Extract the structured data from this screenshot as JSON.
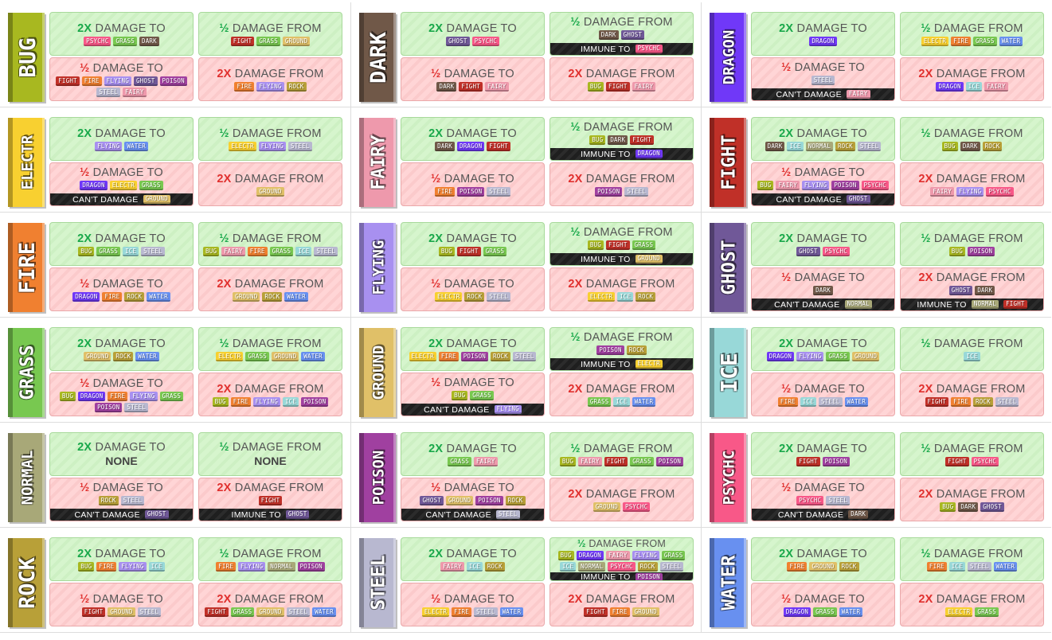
{
  "labels": {
    "damage_to_2x": "DAMAGE TO",
    "damage_to_half": "DAMAGE TO",
    "damage_from_half": "DAMAGE FROM",
    "damage_from_2x": "DAMAGE FROM",
    "mult_2x": "2X",
    "mult_half": "½",
    "cant_damage": "CAN'T DAMAGE",
    "immune_to": "IMMUNE TO",
    "none": "NONE"
  },
  "type_colors": {
    "BUG": "#a8b820",
    "DARK": "#705848",
    "DRAGON": "#7038f8",
    "ELECTR": "#f8d030",
    "FAIRY": "#ee99ac",
    "FIGHT": "#c03028",
    "FIRE": "#f08030",
    "FLYING": "#a890f0",
    "GHOST": "#705898",
    "GRASS": "#78c850",
    "GROUND": "#e0c068",
    "ICE": "#98d8d8",
    "NORMAL": "#a8a878",
    "POISON": "#a040a0",
    "PSYCHC": "#f85888",
    "ROCK": "#b8a038",
    "STEEL": "#b8b8d0",
    "WATER": "#6890f0"
  },
  "types": [
    {
      "name": "BUG",
      "color": "#a8b820",
      "to2x": [
        "PSYCHC",
        "GRASS",
        "DARK"
      ],
      "toHalf": [
        "FIGHT",
        "FIRE",
        "FLYING",
        "GHOST",
        "POISON",
        "STEEL",
        "FAIRY"
      ],
      "fromHalf": [
        "FIGHT",
        "GRASS",
        "GROUND"
      ],
      "from2x": [
        "FIRE",
        "FLYING",
        "ROCK"
      ]
    },
    {
      "name": "DARK",
      "color": "#705848",
      "to2x": [
        "GHOST",
        "PSYCHC"
      ],
      "toHalf": [
        "DARK",
        "FIGHT",
        "FAIRY"
      ],
      "fromHalf": [
        "DARK",
        "GHOST"
      ],
      "immune": [
        "PSYCHC"
      ],
      "from2x": [
        "BUG",
        "FIGHT",
        "FAIRY"
      ]
    },
    {
      "name": "DRAGON",
      "color": "#7038f8",
      "to2x": [
        "DRAGON"
      ],
      "toHalf": [
        "STEEL"
      ],
      "cant": [
        "FAIRY"
      ],
      "fromHalf": [
        "ELECTR",
        "FIRE",
        "GRASS",
        "WATER"
      ],
      "from2x": [
        "DRAGON",
        "ICE",
        "FAIRY"
      ]
    },
    {
      "name": "ELECTR",
      "color": "#f8d030",
      "to2x": [
        "FLYING",
        "WATER"
      ],
      "toHalf": [
        "DRAGON",
        "ELECTR",
        "GRASS"
      ],
      "cant": [
        "GROUND"
      ],
      "fromHalf": [
        "ELECTR",
        "FLYING",
        "STEEL"
      ],
      "from2x": [
        "GROUND"
      ]
    },
    {
      "name": "FAIRY",
      "color": "#ee99ac",
      "to2x": [
        "DARK",
        "DRAGON",
        "FIGHT"
      ],
      "toHalf": [
        "FIRE",
        "POISON",
        "STEEL"
      ],
      "fromHalf": [
        "BUG",
        "DARK",
        "FIGHT"
      ],
      "immune": [
        "DRAGON"
      ],
      "from2x": [
        "POISON",
        "STEEL"
      ]
    },
    {
      "name": "FIGHT",
      "color": "#c03028",
      "to2x": [
        "DARK",
        "ICE",
        "NORMAL",
        "ROCK",
        "STEEL"
      ],
      "toHalf": [
        "BUG",
        "FAIRY",
        "FLYING",
        "POISON",
        "PSYCHC"
      ],
      "cant": [
        "GHOST"
      ],
      "fromHalf": [
        "BUG",
        "DARK",
        "ROCK"
      ],
      "from2x": [
        "FAIRY",
        "FLYING",
        "PSYCHC"
      ]
    },
    {
      "name": "FIRE",
      "color": "#f08030",
      "to2x": [
        "BUG",
        "GRASS",
        "ICE",
        "STEEL"
      ],
      "toHalf": [
        "DRAGON",
        "FIRE",
        "ROCK",
        "WATER"
      ],
      "fromHalf": [
        "BUG",
        "FAIRY",
        "FIRE",
        "GRASS",
        "ICE",
        "STEEL"
      ],
      "from2x": [
        "GROUND",
        "ROCK",
        "WATER"
      ]
    },
    {
      "name": "FLYING",
      "color": "#a890f0",
      "to2x": [
        "BUG",
        "FIGHT",
        "GRASS"
      ],
      "toHalf": [
        "ELECTR",
        "ROCK",
        "STEEL"
      ],
      "fromHalf": [
        "BUG",
        "FIGHT",
        "GRASS"
      ],
      "immune": [
        "GROUND"
      ],
      "from2x": [
        "ELECTR",
        "ICE",
        "ROCK"
      ]
    },
    {
      "name": "GHOST",
      "color": "#705898",
      "to2x": [
        "GHOST",
        "PSYCHC"
      ],
      "toHalf": [
        "DARK"
      ],
      "cant": [
        "NORMAL"
      ],
      "fromHalf": [
        "BUG",
        "POISON"
      ],
      "from2x": [
        "GHOST",
        "DARK"
      ],
      "immune2": [
        "NORMAL",
        "FIGHT"
      ]
    },
    {
      "name": "GRASS",
      "color": "#78c850",
      "to2x": [
        "GROUND",
        "ROCK",
        "WATER"
      ],
      "toHalf": [
        "BUG",
        "DRAGON",
        "FIRE",
        "FLYING",
        "GRASS",
        "POISON",
        "STEEL"
      ],
      "fromHalf": [
        "ELECTR",
        "GRASS",
        "GROUND",
        "WATER"
      ],
      "from2x": [
        "BUG",
        "FIRE",
        "FLYING",
        "ICE",
        "POISON"
      ]
    },
    {
      "name": "GROUND",
      "color": "#e0c068",
      "to2x": [
        "ELECTR",
        "FIRE",
        "POISON",
        "ROCK",
        "STEEL"
      ],
      "toHalf": [
        "BUG",
        "GRASS"
      ],
      "cant": [
        "FLYING"
      ],
      "fromHalf": [
        "POISON",
        "ROCK"
      ],
      "immune": [
        "ELECTR"
      ],
      "from2x": [
        "GRASS",
        "ICE",
        "WATER"
      ]
    },
    {
      "name": "ICE",
      "color": "#98d8d8",
      "to2x": [
        "DRAGON",
        "FLYING",
        "GRASS",
        "GROUND"
      ],
      "toHalf": [
        "FIRE",
        "ICE",
        "STEEL",
        "WATER"
      ],
      "fromHalf": [
        "ICE"
      ],
      "from2x": [
        "FIGHT",
        "FIRE",
        "ROCK",
        "STEEL"
      ]
    },
    {
      "name": "NORMAL",
      "color": "#a8a878",
      "to2x": [],
      "to2xNone": "NONE",
      "toHalf": [
        "ROCK",
        "STEEL"
      ],
      "cant": [
        "GHOST"
      ],
      "fromHalf": [],
      "fromHalfNone": "NONE",
      "from2x": [
        "FIGHT"
      ],
      "immune2": [
        "GHOST"
      ]
    },
    {
      "name": "POISON",
      "color": "#a040a0",
      "to2x": [
        "GRASS",
        "FAIRY"
      ],
      "toHalf": [
        "GHOST",
        "GROUND",
        "POISON",
        "ROCK"
      ],
      "cant": [
        "STEEL"
      ],
      "fromHalf": [
        "BUG",
        "FAIRY",
        "FIGHT",
        "GRASS",
        "POISON"
      ],
      "from2x": [
        "GROUND",
        "PSYCHC"
      ]
    },
    {
      "name": "PSYCHC",
      "color": "#f85888",
      "to2x": [
        "FIGHT",
        "POISON"
      ],
      "toHalf": [
        "PSYCHC",
        "STEEL"
      ],
      "cant": [
        "DARK"
      ],
      "fromHalf": [
        "FIGHT",
        "PSYCHC"
      ],
      "from2x": [
        "BUG",
        "DARK",
        "GHOST"
      ]
    },
    {
      "name": "ROCK",
      "color": "#b8a038",
      "to2x": [
        "BUG",
        "FIRE",
        "FLYING",
        "ICE"
      ],
      "toHalf": [
        "FIGHT",
        "GROUND",
        "STEEL"
      ],
      "fromHalf": [
        "FIRE",
        "FLYING",
        "NORMAL",
        "POISON"
      ],
      "from2x": [
        "FIGHT",
        "GRASS",
        "GROUND",
        "STEEL",
        "WATER"
      ]
    },
    {
      "name": "STEEL",
      "color": "#b8b8d0",
      "to2x": [
        "FAIRY",
        "ICE",
        "ROCK"
      ],
      "toHalf": [
        "ELECTR",
        "FIRE",
        "STEEL",
        "WATER"
      ],
      "fromHalf": [
        "BUG",
        "DRAGON",
        "FAIRY",
        "FLYING",
        "GRASS",
        "ICE",
        "NORMAL",
        "PSYCHC",
        "ROCK",
        "STEEL"
      ],
      "immune": [
        "POISON"
      ],
      "from2x": [
        "FIGHT",
        "FIRE",
        "GROUND"
      ]
    },
    {
      "name": "WATER",
      "color": "#6890f0",
      "to2x": [
        "FIRE",
        "GROUND",
        "ROCK"
      ],
      "toHalf": [
        "DRAGON",
        "GRASS",
        "WATER"
      ],
      "fromHalf": [
        "FIRE",
        "ICE",
        "STEEL",
        "WATER"
      ],
      "from2x": [
        "ELECTR",
        "GRASS"
      ]
    }
  ]
}
